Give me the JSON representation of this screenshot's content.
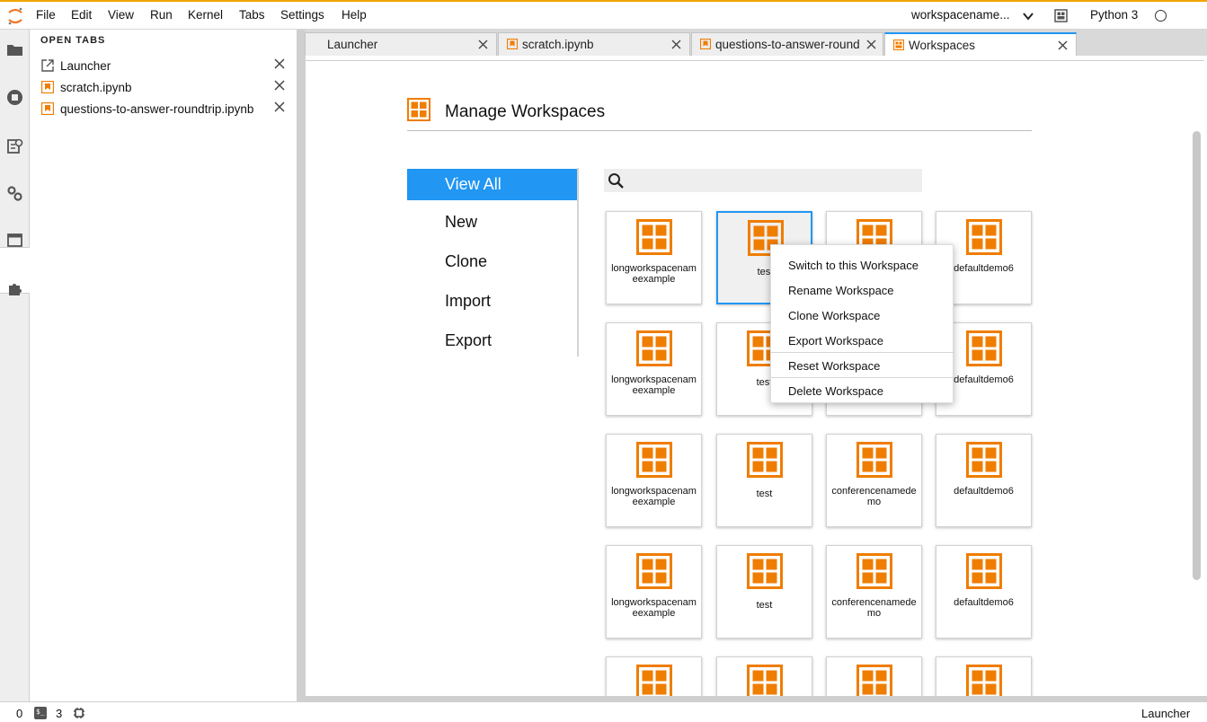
{
  "menu": [
    "File",
    "Edit",
    "View",
    "Run",
    "Kernel",
    "Tabs",
    "Settings",
    "Help"
  ],
  "workspace_selector": "workspacename...",
  "kernel": {
    "name": "Python 3",
    "status": "idle"
  },
  "side_panel": {
    "title": "OPEN TABS",
    "items": [
      {
        "label": "Launcher",
        "icon": "launcher-icon"
      },
      {
        "label": "scratch.ipynb",
        "icon": "notebook-icon"
      },
      {
        "label": "questions-to-answer-roundtrip.ipynb",
        "icon": "notebook-icon"
      }
    ]
  },
  "doc_tabs": [
    {
      "label": "Launcher",
      "icon": "none",
      "active": false
    },
    {
      "label": "scratch.ipynb",
      "icon": "notebook-icon",
      "active": false
    },
    {
      "label": "questions-to-answer-round",
      "icon": "notebook-icon",
      "active": false
    },
    {
      "label": "Workspaces",
      "icon": "workspace-icon",
      "active": true
    }
  ],
  "workspaces_page": {
    "title": "Manage Workspaces",
    "nav": [
      "View All",
      "New",
      "Clone",
      "Import",
      "Export"
    ],
    "active_nav": "View All",
    "search_placeholder": "",
    "cards": [
      "longworkspacenameexample",
      "test",
      "",
      "defaultdemo6",
      "longworkspacenameexample",
      "test",
      "",
      "defaultdemo6",
      "longworkspacenameexample",
      "test",
      "conferencenamedemo",
      "defaultdemo6",
      "longworkspacenameexample",
      "test",
      "conferencenamedemo",
      "defaultdemo6"
    ],
    "selected_card": "test"
  },
  "context_menu": {
    "items": [
      "Switch to this Workspace",
      "Rename Workspace",
      "Clone Workspace",
      "Export Workspace",
      "Reset Workspace",
      "Delete Workspace"
    ]
  },
  "status_bar": {
    "left_count": "0",
    "terminals": "3",
    "right_label": "Launcher"
  },
  "colors": {
    "accent": "#2196f3",
    "workspace_icon": "#ef7d00",
    "menu_accent": "#f0a500"
  }
}
